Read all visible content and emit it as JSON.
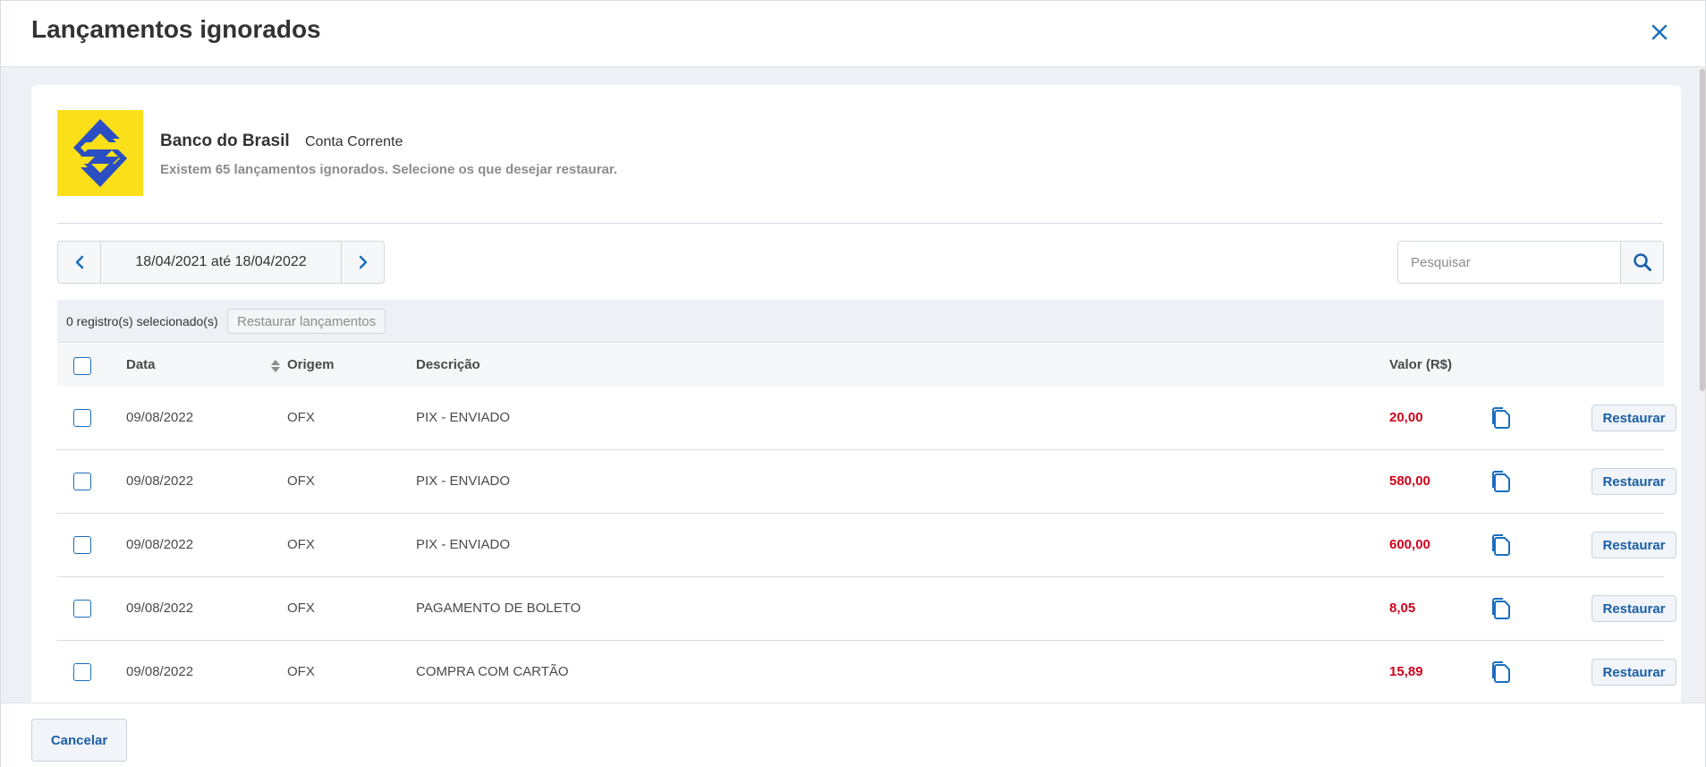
{
  "modal": {
    "title": "Lançamentos ignorados"
  },
  "bank": {
    "name": "Banco do Brasil",
    "account_type": "Conta Corrente",
    "info": "Existem 65 lançamentos ignorados. Selecione os que desejar restaurar."
  },
  "filters": {
    "date_range": "18/04/2021 até 18/04/2022",
    "search_placeholder": "Pesquisar"
  },
  "selection": {
    "count_label": "0 registro(s) selecionado(s)",
    "restore_bulk_label": "Restaurar lançamentos"
  },
  "table": {
    "headers": {
      "date": "Data",
      "origin": "Origem",
      "description": "Descrição",
      "value": "Valor (R$)"
    },
    "rows": [
      {
        "date": "09/08/2022",
        "origin": "OFX",
        "description": "PIX - ENVIADO",
        "value": "20,00",
        "action": "Restaurar"
      },
      {
        "date": "09/08/2022",
        "origin": "OFX",
        "description": "PIX - ENVIADO",
        "value": "580,00",
        "action": "Restaurar"
      },
      {
        "date": "09/08/2022",
        "origin": "OFX",
        "description": "PIX - ENVIADO",
        "value": "600,00",
        "action": "Restaurar"
      },
      {
        "date": "09/08/2022",
        "origin": "OFX",
        "description": "PAGAMENTO DE BOLETO",
        "value": "8,05",
        "action": "Restaurar"
      },
      {
        "date": "09/08/2022",
        "origin": "OFX",
        "description": "COMPRA COM CARTÃO",
        "value": "15,89",
        "action": "Restaurar"
      }
    ]
  },
  "footer": {
    "cancel_label": "Cancelar"
  },
  "colors": {
    "accent": "#1a6fbf",
    "negative_value": "#d0021b",
    "bank_yellow": "#fbe019",
    "bank_blue": "#2b4ec3"
  }
}
